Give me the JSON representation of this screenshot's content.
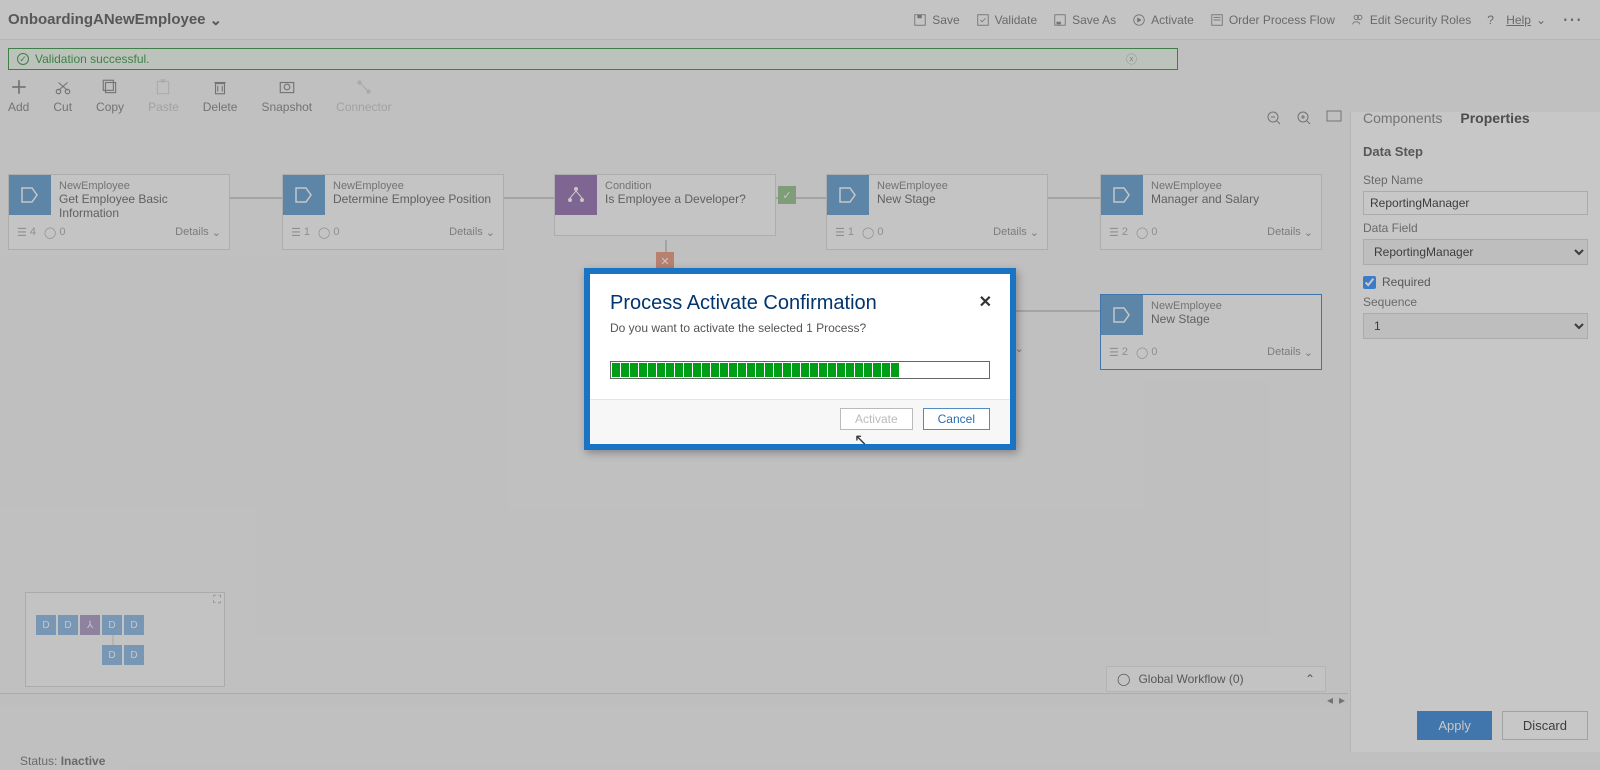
{
  "title": "OnboardingANewEmployee",
  "topActions": {
    "save": "Save",
    "validate": "Validate",
    "saveAs": "Save As",
    "activate": "Activate",
    "order": "Order Process Flow",
    "security": "Edit Security Roles",
    "help": "Help"
  },
  "validation": "Validation successful.",
  "toolbar": {
    "add": "Add",
    "cut": "Cut",
    "copy": "Copy",
    "paste": "Paste",
    "delete": "Delete",
    "snapshot": "Snapshot",
    "connector": "Connector"
  },
  "stages": {
    "s1": {
      "t1": "NewEmployee",
      "t2": "Get Employee Basic Information",
      "m1": "4",
      "m2": "0",
      "details": "Details"
    },
    "s2": {
      "t1": "NewEmployee",
      "t2": "Determine Employee Position",
      "m1": "1",
      "m2": "0",
      "details": "Details"
    },
    "s3": {
      "t1": "Condition",
      "t2": "Is Employee a Developer?"
    },
    "s4": {
      "t1": "NewEmployee",
      "t2": "New Stage",
      "m1": "1",
      "m2": "0",
      "details": "Details"
    },
    "s5": {
      "t1": "NewEmployee",
      "t2": "Manager and Salary",
      "m1": "2",
      "m2": "0",
      "details": "Details"
    },
    "s6": {
      "t1": "NewEmployee",
      "t2": "New Stage",
      "m1": "2",
      "m2": "0",
      "details": "Details"
    }
  },
  "chev": "⌄",
  "rightPanel": {
    "tabs": {
      "components": "Components",
      "properties": "Properties"
    },
    "header": "Data Step",
    "stepNameLabel": "Step Name",
    "stepName": "ReportingManager",
    "dataFieldLabel": "Data Field",
    "dataField": "ReportingManager",
    "requiredLabel": "Required",
    "sequenceLabel": "Sequence",
    "sequence": "1",
    "apply": "Apply",
    "discard": "Discard"
  },
  "globalWorkflow": "Global Workflow (0)",
  "status": {
    "label": "Status:",
    "value": "Inactive"
  },
  "modal": {
    "title": "Process Activate Confirmation",
    "msg": "Do you want to activate the selected 1 Process?",
    "activate": "Activate",
    "cancel": "Cancel"
  }
}
